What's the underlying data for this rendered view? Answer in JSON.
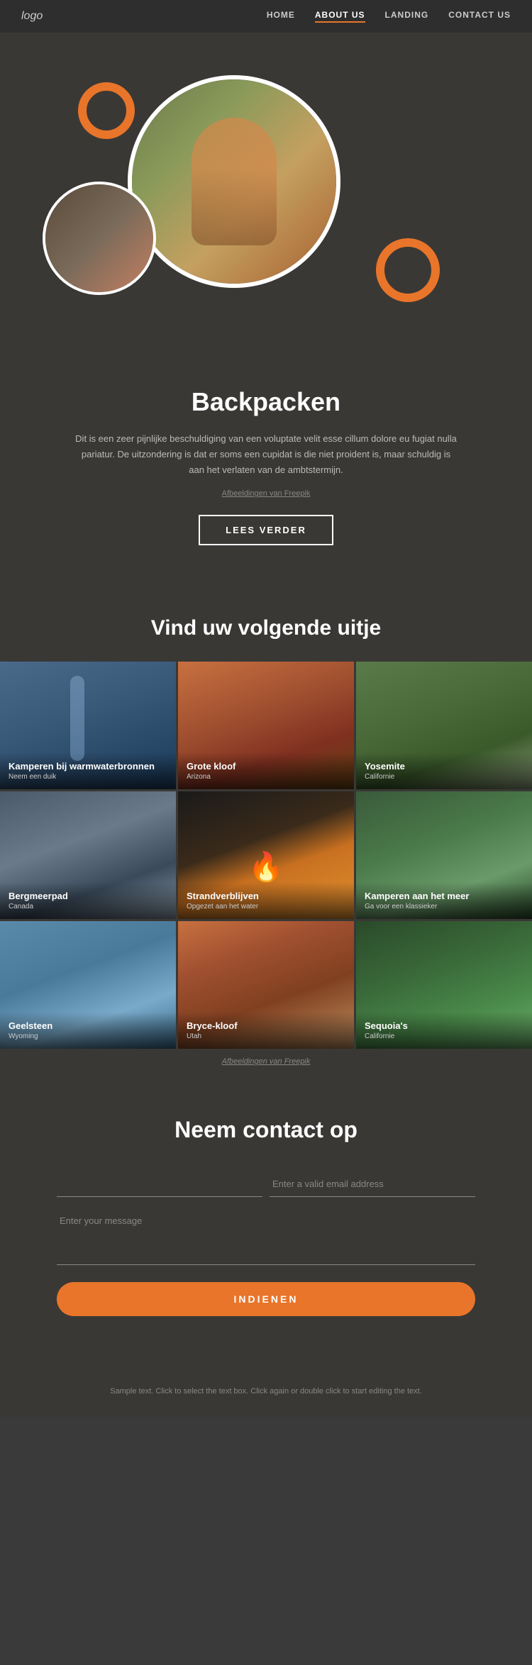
{
  "nav": {
    "logo": "logo",
    "links": [
      {
        "label": "HOME",
        "id": "home",
        "active": false
      },
      {
        "label": "ABOUT US",
        "id": "about",
        "active": true
      },
      {
        "label": "LANDING",
        "id": "landing",
        "active": false
      },
      {
        "label": "CONTACT US",
        "id": "contact",
        "active": false
      }
    ]
  },
  "hero": {
    "title": "Backpacken",
    "description": "Dit is een zeer pijnlijke beschuldiging van een voluptate velit esse cillum dolore eu fugiat nulla pariatur. De uitzondering is dat er soms een cupidat is die niet proident is, maar schuldig is aan het verlaten van de ambtstermijn.",
    "credit_text": "Afbeeldingen van Freepik",
    "btn_label": "LEES VERDER"
  },
  "vind": {
    "title": "Vind uw volgende uitje",
    "grid": [
      {
        "id": "waterfall",
        "title": "Kamperen bij warmwaterbronnen",
        "subtitle": "Neem een duik",
        "photo_class": "photo-waterfall"
      },
      {
        "id": "canyon",
        "title": "Grote kloof",
        "subtitle": "Arizona",
        "photo_class": "photo-canyon"
      },
      {
        "id": "yosemite",
        "title": "Yosemite",
        "subtitle": "Californie",
        "photo_class": "photo-yosemite"
      },
      {
        "id": "mountain",
        "title": "Bergmeerpad",
        "subtitle": "Canada",
        "photo_class": "photo-mountain"
      },
      {
        "id": "fire",
        "title": "Strandverblijven",
        "subtitle": "Opgezet aan het water",
        "photo_class": "photo-fire"
      },
      {
        "id": "lake",
        "title": "Kamperen aan het meer",
        "subtitle": "Ga voor een klassieker",
        "photo_class": "photo-lake"
      },
      {
        "id": "beach",
        "title": "Geelsteen",
        "subtitle": "Wyoming",
        "photo_class": "photo-beach"
      },
      {
        "id": "bryce",
        "title": "Bryce-kloof",
        "subtitle": "Utah",
        "photo_class": "photo-bryce"
      },
      {
        "id": "sequoia",
        "title": "Sequoia's",
        "subtitle": "Californie",
        "photo_class": "photo-sequoia"
      }
    ],
    "credit_text": "Afbeeldingen van Freepik"
  },
  "contact": {
    "title": "Neem contact op",
    "name_placeholder": "",
    "email_placeholder": "Enter a valid email address",
    "message_placeholder": "Enter your message",
    "submit_label": "INDIENEN"
  },
  "footer": {
    "note": "Sample text. Click to select the text box. Click again or double click to start editing the text."
  }
}
